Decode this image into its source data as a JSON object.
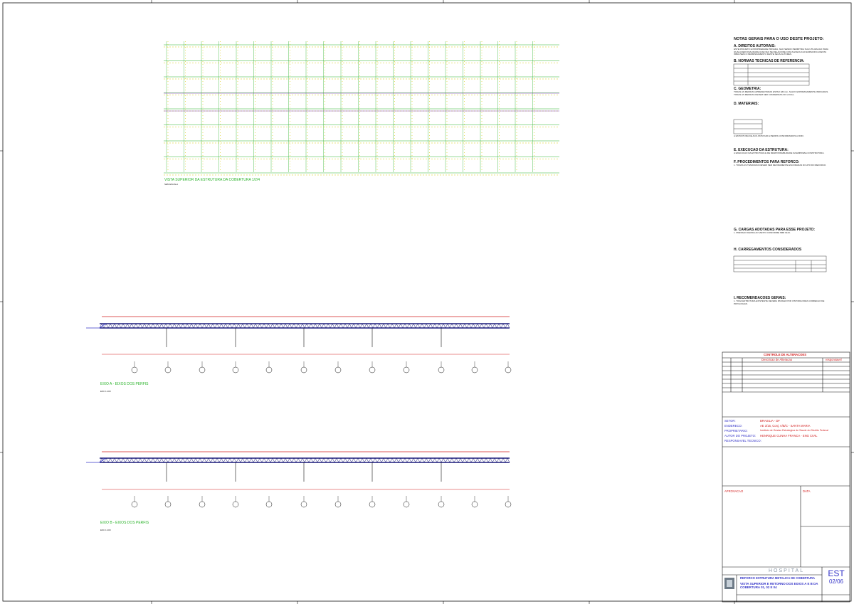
{
  "notes": {
    "title": "NOTAS GERAIS PARA O USO DESTE PROJETO:",
    "sections": [
      {
        "heading": "A. DIREITOS AUTORAIS:",
        "body": "ESTE PROJETO E PROPRIEDADE PRIVADA, NAO SENDO PERMITIDA SUA UTILIZACAO PARA QUALQUER FINALIDADE QUE NAO SE RELACIONE COM A EXECUCAO ESPECIFICA DESTA OBRA SEM O PERMISSAMENTO DESTE SEUS AUTORES."
      },
      {
        "heading": "B. NORMAS TECNICAS DE REFERENCIA:",
        "body": ""
      },
      {
        "heading": "C. GEOMETRIA:",
        "body": "TODAS AS MEDIDAS APRESENTADAS ESTAO EM mm, SALVO EXPRESSAMENTE INDICADAS. TODAS AS MEDIDAS DEVEM SER CONFERIDAS NO LOCAL."
      },
      {
        "heading": "D. MATERIAIS:",
        "body": "A ESTRUTURA DE ACO ASTM A36 E PERFIS CONFORMADOS A FRIO."
      },
      {
        "heading": "E. EXECUCAO DA ESTRUTURA:",
        "body": "A EXECUCAO DA ESTRUTURA E DE RESPONSABILIDADE DA EMPRESA CONSTRUTORA."
      },
      {
        "heading": "F. PROCEDIMENTOS PARA REFORCO:",
        "body": "1. TODAS AS TESOURAS DEVEM SER DEVIDAMENTE ESCORADAS NO ATO DO REFORCO."
      },
      {
        "heading": "G. CARGAS ADOTADAS PARA ESSE PROJETO:",
        "body": "1. PRESSAO DEVIDA AO VENTO CONFORME NBR 6123."
      },
      {
        "heading": "H. CARREGAMENTOS CONSIDERADOS",
        "body": ""
      },
      {
        "heading": "I. RECOMENDACOES GERAIS:",
        "body": "1. TODA ESTRUTURA EXISTENTE DEVERA PASSAR POR VISTORIA PARA CORRECAO DE PATOLOGIAS."
      }
    ]
  },
  "views": {
    "top_title": "VISTA SUPERIOR DA ESTRUTURA DA COBERTURA 1/2/4",
    "top_sub": "SEM ESCALA",
    "eixo_a_title": "EIXO A - EIXOS DOS PERFIS",
    "eixo_a_sub": "ESC 1:100",
    "eixo_b_title": "EIXO B - EIXOS DOS PERFIS",
    "eixo_b_sub": "ESC 1:100"
  },
  "revisions": {
    "title": "CONTROLE DE ALTERACOES",
    "header_desc": "Descricao de Alteracao",
    "header_resp": "responsavel"
  },
  "titleblock": {
    "setor_label": "SETOR:",
    "setor": "BRASILIA - DF",
    "endereco_label": "ENDERECO:",
    "endereco": "AE 3/15, Conj. A/B/C - SANTA MARIA",
    "proprietario_label": "PROPRIETARIO:",
    "proprietario": "Instituto de Gestao Estrategica de Saude do Distrito Federal",
    "autor_label": "AUTOR DO PROJETO:",
    "autor": "HENRIQUE CUNHA FRANCA - ENG CIVIL",
    "resp_label": "RESPONSAVEL TECNICO:",
    "aprovacao": "APROVACAO",
    "data": "DATA",
    "hospital": "HOSPITAL",
    "obra": "REFORCO ESTRUTURA METALICA DE COBERTURA",
    "detalhe": "VISTA SUPERIOR E RETORNO DOS EIXOS A E B DA COBERTURA 01, 02 E 04",
    "sheet_code": "EST",
    "sheet_num": "02/06"
  },
  "colors": {
    "green": "#2bb32b",
    "red": "#d21f1f",
    "blue": "#3434c8",
    "yellow": "#d8c800",
    "frame": "#111111"
  }
}
